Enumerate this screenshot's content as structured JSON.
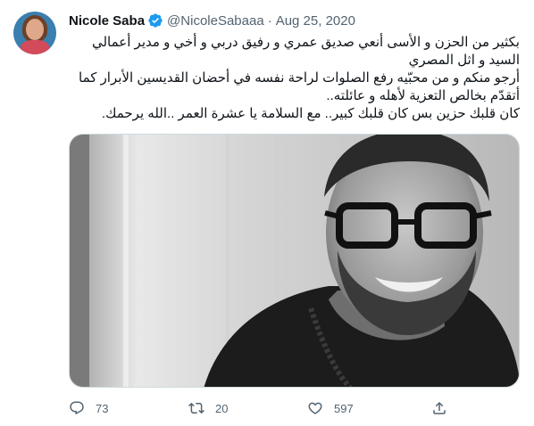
{
  "tweet": {
    "author_name": "Nicole Saba",
    "handle": "@NicoleSabaaa",
    "separator": "·",
    "date": "Aug 25, 2020",
    "verified_icon": "verified-badge-icon",
    "text_lines": [
      "بكثير من الحزن و الأسى أنعي صديق عمري و رفيق دربي و أخي و مدير أعمالي",
      "السيد و اثل المصري",
      "أرجو منكم و من محبّيه رفع الصلوات لراحة نفسه في أحضان القديسين الأبرار كما",
      "أتقدّم بخالص التعزية لأهله و عائلته..",
      "كان قلبك حزين بس كان قلبك كبير.. مع السلامة يا عشرة العمر ..الله يرحمك."
    ],
    "colors": {
      "text": "#0f1419",
      "secondary": "#536471",
      "verified": "#1d9bf0"
    }
  },
  "actions": {
    "reply": {
      "icon": "reply-icon",
      "count": "73"
    },
    "retweet": {
      "icon": "retweet-icon",
      "count": "20"
    },
    "like": {
      "icon": "like-icon",
      "count": "597"
    },
    "share": {
      "icon": "share-icon"
    }
  }
}
